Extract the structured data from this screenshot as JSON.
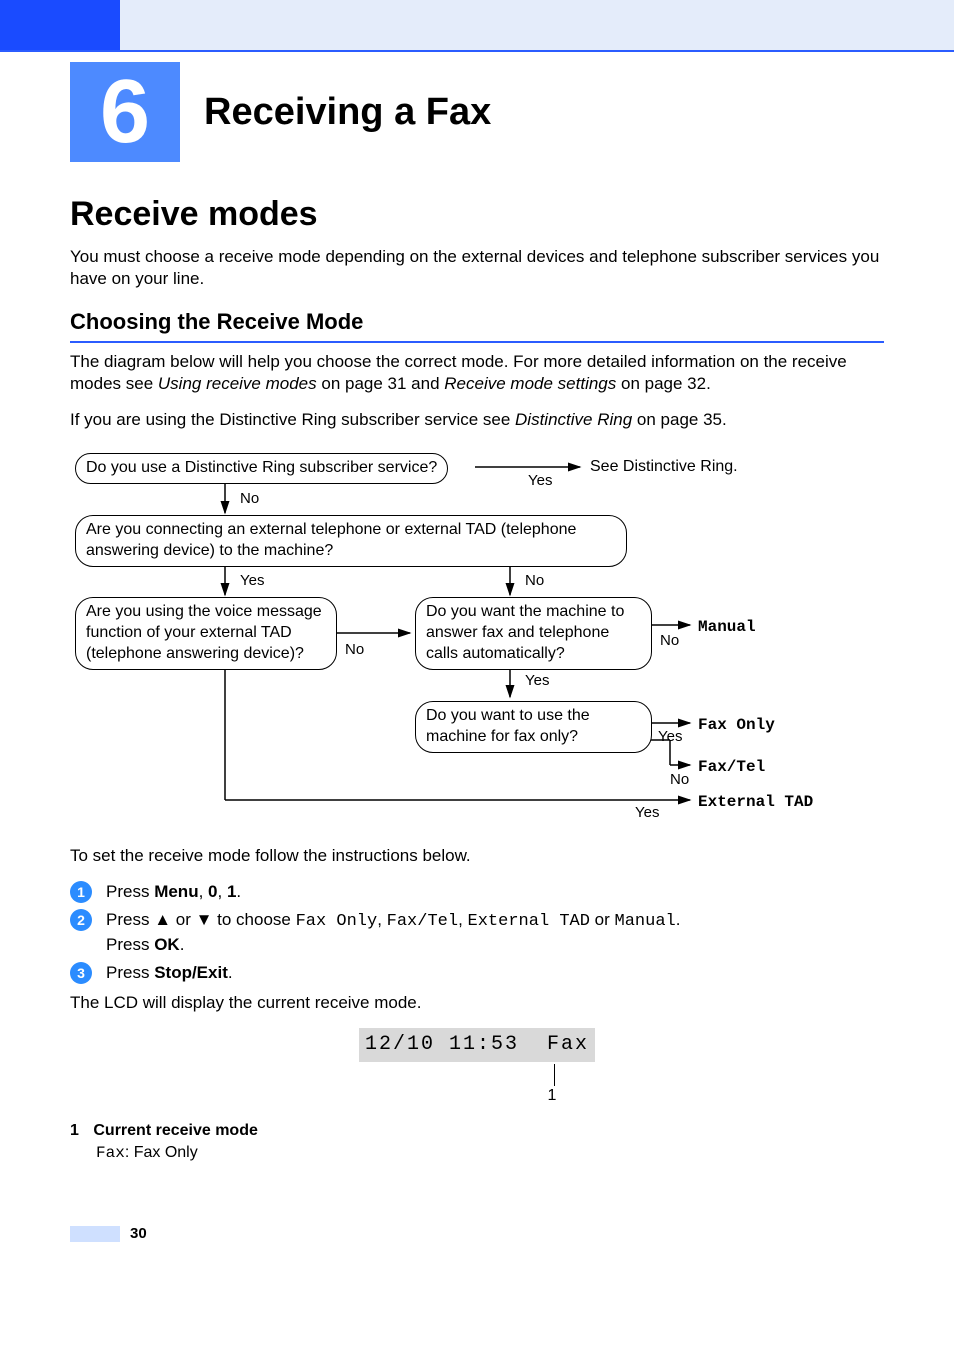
{
  "chapter": {
    "number": "6",
    "title": "Receiving a Fax"
  },
  "section": {
    "title": "Receive modes",
    "intro": "You must choose a receive mode depending on the external devices and telephone subscriber services you have on your line."
  },
  "subsection": {
    "title": "Choosing the Receive Mode",
    "p1_a": "The diagram below will help you choose the correct mode. For more detailed information on the receive modes see ",
    "p1_link1": "Using receive modes",
    "p1_b": " on page 31 and ",
    "p1_link2": "Receive mode settings",
    "p1_c": " on page 32.",
    "p2_a": "If you are using the Distinctive Ring subscriber service see ",
    "p2_link": "Distinctive Ring",
    "p2_b": " on page 35."
  },
  "flow": {
    "q1": "Do you use a Distinctive Ring subscriber service?",
    "r1": "See Distinctive Ring.",
    "q2": "Are you connecting an external telephone or external TAD (telephone answering device) to the machine?",
    "q3": "Are you using the voice message function of your external TAD (telephone answering device)?",
    "q4": "Do you want the machine to answer fax and telephone calls automatically?",
    "q5": "Do you want to use the machine for fax only?",
    "mode_manual": "Manual",
    "mode_faxonly": "Fax Only",
    "mode_faxtel": "Fax/Tel",
    "mode_exttad": "External TAD",
    "yes": "Yes",
    "no": "No"
  },
  "instructions_intro": "To set the receive mode follow the instructions below.",
  "steps": {
    "s1_a": "Press ",
    "s1_menu": "Menu",
    "s1_b": ", ",
    "s1_zero": "0",
    "s1_c": ", ",
    "s1_one": "1",
    "s1_d": ".",
    "s2_a": "Press ",
    "s2_up": "▲",
    "s2_b": " or ",
    "s2_down": "▼",
    "s2_c": " to choose ",
    "s2_opt1": "Fax Only",
    "s2_sep": ", ",
    "s2_opt2": "Fax/Tel",
    "s2_opt3": "External TAD",
    "s2_or": " or ",
    "s2_opt4": "Manual",
    "s2_d": ".",
    "s2_press": "Press ",
    "s2_ok": "OK",
    "s2_e": ".",
    "s3_a": "Press ",
    "s3_stop": "Stop/Exit",
    "s3_b": "."
  },
  "after_steps": "The LCD will display the current receive mode.",
  "lcd": {
    "text": "12/10 11:53  Fax",
    "callout": "1"
  },
  "legend": {
    "num": "1",
    "title": "Current receive mode",
    "code": "Fax",
    "desc": ": Fax Only"
  },
  "page_number": "30",
  "chart_data": {
    "type": "table",
    "description": "Decision flowchart for selecting a fax receive mode",
    "nodes": [
      {
        "id": "q1",
        "text": "Do you use a Distinctive Ring subscriber service?",
        "yes": "r_distinctive",
        "no": "q2"
      },
      {
        "id": "r_distinctive",
        "text": "See Distinctive Ring.",
        "terminal": true
      },
      {
        "id": "q2",
        "text": "Are you connecting an external telephone or external TAD (telephone answering device) to the machine?",
        "yes": "q3",
        "no": "q4"
      },
      {
        "id": "q3",
        "text": "Are you using the voice message function of your external TAD (telephone answering device)?",
        "yes": "r_exttad",
        "no": "q4"
      },
      {
        "id": "q4",
        "text": "Do you want the machine to answer fax and telephone calls automatically?",
        "yes": "q5",
        "no": "r_manual"
      },
      {
        "id": "q5",
        "text": "Do you want to use the machine for fax only?",
        "yes": "r_faxonly",
        "no": "r_faxtel"
      },
      {
        "id": "r_manual",
        "text": "Manual",
        "terminal": true
      },
      {
        "id": "r_faxonly",
        "text": "Fax Only",
        "terminal": true
      },
      {
        "id": "r_faxtel",
        "text": "Fax/Tel",
        "terminal": true
      },
      {
        "id": "r_exttad",
        "text": "External TAD",
        "terminal": true
      }
    ]
  }
}
